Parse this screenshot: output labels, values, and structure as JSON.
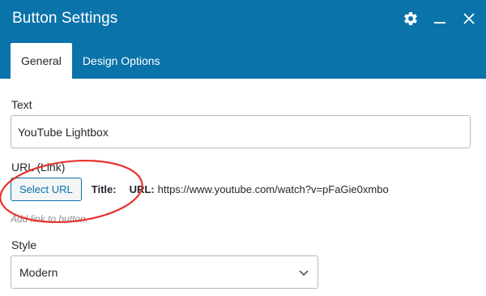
{
  "window": {
    "title": "Button Settings",
    "icons": [
      "gear-icon",
      "minimize-icon",
      "close-icon"
    ]
  },
  "tabs": [
    {
      "label": "General",
      "active": true
    },
    {
      "label": "Design Options",
      "active": false
    }
  ],
  "fields": {
    "text": {
      "label": "Text",
      "value": "YouTube Lightbox"
    },
    "url": {
      "label": "URL (Link)",
      "button_label": "Select URL",
      "title_label": "Title:",
      "url_label": "URL:",
      "url_value": "https://www.youtube.com/watch?v=pFaGie0xmbo",
      "help": "Add link to button."
    },
    "style": {
      "label": "Style",
      "selected": "Modern"
    }
  },
  "colors": {
    "header_bg": "#0a73aa",
    "accent": "#0a73aa",
    "annotation": "#e8322c"
  }
}
